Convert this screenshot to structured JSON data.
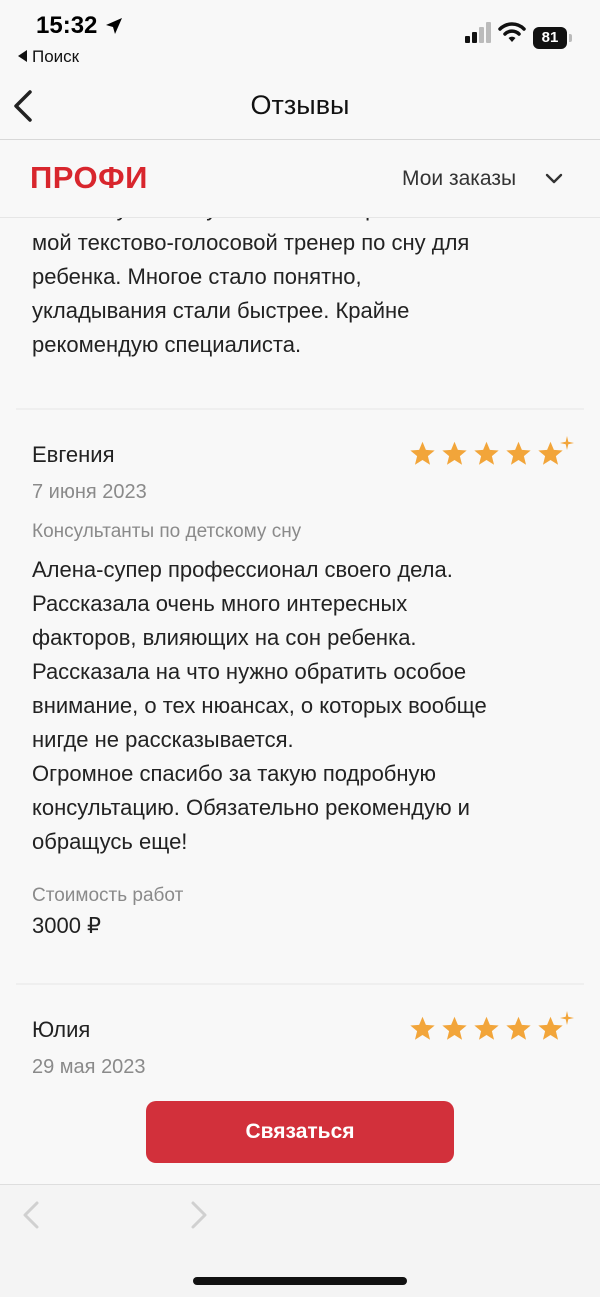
{
  "status_bar": {
    "time": "15:32",
    "back_app": "Поиск",
    "battery": "81"
  },
  "nav": {
    "title": "Отзывы"
  },
  "header": {
    "logo": "ПРОФИ",
    "orders": "Мои заказы"
  },
  "reviews": {
    "partial_top": {
      "text": "моем случае получилось Алена работала как\nмой текстово-голосовой тренер по сну для\nребенка. Многое стало понятно,\nукладывания стали быстрее. Крайне\nрекомендую специалиста."
    },
    "r1": {
      "author": "Евгения",
      "rating": 5,
      "date": "7 июня 2023",
      "category": "Консультанты по детскому сну",
      "text": "Алена-супер профессионал своего дела.\nРассказала очень много интересных\nфакторов, влияющих на сон ребенка.\nРассказала на что нужно обратить особое\nвнимание, о тех нюансах, о которых вообще\nнигде не рассказывается.\nОгромное спасибо за такую подробную\nконсультацию. Обязательно рекомендую и\nобращусь еще!",
      "cost_label": "Стоимость работ",
      "cost": "3000 ₽"
    },
    "r2": {
      "author": "Юлия",
      "rating": 5,
      "date": "29 мая 2023"
    }
  },
  "contact_button": "Связаться",
  "colors": {
    "brand": "#d8262d",
    "button": "#d2303b",
    "star": "#f2a53a"
  }
}
